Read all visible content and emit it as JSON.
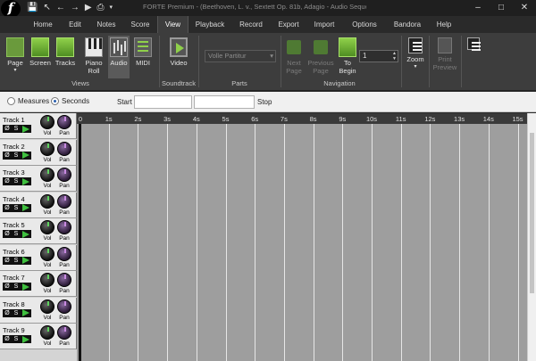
{
  "app": {
    "logo_letter": "f",
    "title": "FORTE Premium - (Beethoven, L. v., Sextett Op. 81b, Adagio - Audio Sequencer)"
  },
  "menu_tabs": [
    "Home",
    "Edit",
    "Notes",
    "Score",
    "View",
    "Playback",
    "Record",
    "Export",
    "Import",
    "Options",
    "Bandora",
    "Help"
  ],
  "active_tab": "View",
  "ribbon": {
    "views": {
      "label": "Views",
      "buttons": [
        {
          "label": "Page",
          "icon": "page-icon"
        },
        {
          "label": "Screen",
          "icon": "screen-icon"
        },
        {
          "label": "Tracks",
          "icon": "tracks-icon"
        },
        {
          "label": "Piano Roll",
          "icon": "piano-roll-icon"
        },
        {
          "label": "Audio",
          "icon": "audio-waveform-icon"
        },
        {
          "label": "MIDI",
          "icon": "midi-icon"
        }
      ]
    },
    "soundtrack": {
      "label": "Soundtrack",
      "video_label": "Video"
    },
    "parts": {
      "label": "Parts",
      "select_value": "Volle Partitur"
    },
    "navigation": {
      "label": "Navigation",
      "next_page": "Next Page",
      "previous_page": "Previous Page",
      "to_begin": "To Begin",
      "page_number": "1"
    },
    "zoom": {
      "label": "Zoom"
    },
    "print_preview": {
      "label": "Print Preview"
    }
  },
  "options": {
    "measures_label": "Measures",
    "seconds_label": "Seconds",
    "selected": "Seconds",
    "start_label": "Start",
    "start_value": "",
    "stop_value": "",
    "stop_label": "Stop"
  },
  "tracks": [
    {
      "name": "Track 1"
    },
    {
      "name": "Track 2"
    },
    {
      "name": "Track 3"
    },
    {
      "name": "Track 4"
    },
    {
      "name": "Track 5"
    },
    {
      "name": "Track 6"
    },
    {
      "name": "Track 7"
    },
    {
      "name": "Track 8"
    },
    {
      "name": "Track 9"
    }
  ],
  "track_controls": {
    "mute_symbol": "Ø",
    "solo_label": "S",
    "vol_label": "Vol",
    "pan_label": "Pan"
  },
  "timeline": {
    "unit": "seconds",
    "ticks": [
      "0",
      "1s",
      "2s",
      "3s",
      "4s",
      "5s",
      "6s",
      "7s",
      "8s",
      "9s",
      "10s",
      "11s",
      "12s",
      "13s",
      "14s",
      "15s"
    ]
  },
  "colors": {
    "accent_green": "#8fd04a",
    "ribbon_bg": "#3d3d3d",
    "timeline_bg": "#9e9e9e"
  }
}
